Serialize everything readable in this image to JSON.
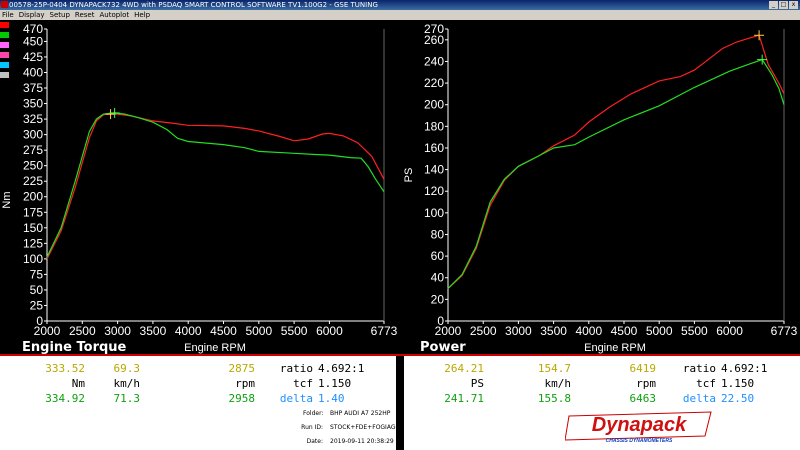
{
  "window": {
    "title": "00578-25P-0404 DYNAPACK732 4WD with PSDAQ SMART CONTROL SOFTWARE TV1.100G2 - GSE TUNING",
    "buttons": [
      "_",
      "□",
      "x"
    ]
  },
  "menu": [
    "File",
    "Display",
    "Setup",
    "Reset",
    "Autoplot",
    "Help"
  ],
  "legend_colors": [
    "#ff0000",
    "#00cc00",
    "#ff66ff",
    "#ff44aa",
    "#00c8ff",
    "#c0c0c0"
  ],
  "charts": {
    "torque": {
      "section_label": "Engine Torque",
      "xlabel": "Engine RPM",
      "ylabel": "Nm"
    },
    "power": {
      "section_label": "Power",
      "xlabel": "Engine RPM",
      "ylabel": "PS"
    }
  },
  "chart_data": [
    {
      "type": "line",
      "xlabel": "Engine RPM",
      "ylabel": "Nm",
      "xlim": [
        2000,
        6773
      ],
      "ylim": [
        0,
        470
      ],
      "x_ticks": [
        "2000",
        "2500",
        "3000",
        "3500",
        "4000",
        "4500",
        "5000",
        "5500",
        "6000",
        "6773"
      ],
      "y_ticks": [
        0,
        25,
        50,
        75,
        100,
        125,
        150,
        175,
        200,
        225,
        250,
        275,
        300,
        325,
        350,
        375,
        400,
        425,
        450,
        470
      ],
      "series": [
        {
          "color": "#ff2020",
          "points": [
            [
              2000,
              100
            ],
            [
              2200,
              145
            ],
            [
              2400,
              215
            ],
            [
              2600,
              295
            ],
            [
              2700,
              322
            ],
            [
              2800,
              332
            ],
            [
              2900,
              333
            ],
            [
              3000,
              333
            ],
            [
              3200,
              330
            ],
            [
              3500,
              322
            ],
            [
              3800,
              318
            ],
            [
              4000,
              315
            ],
            [
              4500,
              314
            ],
            [
              4800,
              310
            ],
            [
              5000,
              306
            ],
            [
              5300,
              297
            ],
            [
              5500,
              290
            ],
            [
              5700,
              293
            ],
            [
              5900,
              301
            ],
            [
              6000,
              302
            ],
            [
              6200,
              298
            ],
            [
              6400,
              287
            ],
            [
              6600,
              265
            ],
            [
              6773,
              228
            ]
          ]
        },
        {
          "color": "#22dd22",
          "points": [
            [
              2000,
              103
            ],
            [
              2200,
              150
            ],
            [
              2400,
              225
            ],
            [
              2600,
              305
            ],
            [
              2700,
              325
            ],
            [
              2800,
              333
            ],
            [
              2958,
              334.92
            ],
            [
              3100,
              333
            ],
            [
              3300,
              327
            ],
            [
              3500,
              320
            ],
            [
              3700,
              308
            ],
            [
              3850,
              294
            ],
            [
              4000,
              289
            ],
            [
              4500,
              284
            ],
            [
              4800,
              279
            ],
            [
              5000,
              273
            ],
            [
              5500,
              270
            ],
            [
              5800,
              268
            ],
            [
              6000,
              267
            ],
            [
              6300,
              263
            ],
            [
              6450,
              262
            ],
            [
              6550,
              248
            ],
            [
              6650,
              229
            ],
            [
              6773,
              208
            ]
          ]
        }
      ]
    },
    {
      "type": "line",
      "xlabel": "Engine RPM",
      "ylabel": "PS",
      "xlim": [
        2000,
        6773
      ],
      "ylim": [
        0,
        270
      ],
      "x_ticks": [
        "2000",
        "2500",
        "3000",
        "3500",
        "4000",
        "4500",
        "5000",
        "5500",
        "6000",
        "6773"
      ],
      "y_ticks": [
        0,
        20,
        40,
        60,
        80,
        100,
        120,
        140,
        160,
        180,
        200,
        220,
        240,
        260,
        270
      ],
      "series": [
        {
          "color": "#ff2020",
          "points": [
            [
              2000,
              30
            ],
            [
              2200,
              42
            ],
            [
              2400,
              67
            ],
            [
              2600,
              107
            ],
            [
              2800,
              130
            ],
            [
              3000,
              143
            ],
            [
              3300,
              153
            ],
            [
              3500,
              162
            ],
            [
              3800,
              172
            ],
            [
              4000,
              184
            ],
            [
              4300,
              198
            ],
            [
              4600,
              210
            ],
            [
              5000,
              222
            ],
            [
              5300,
              226
            ],
            [
              5500,
              232
            ],
            [
              5700,
              242
            ],
            [
              5900,
              252
            ],
            [
              6100,
              258
            ],
            [
              6300,
              262
            ],
            [
              6419,
              264.21
            ],
            [
              6550,
              237
            ],
            [
              6700,
              220
            ],
            [
              6773,
              210
            ]
          ]
        },
        {
          "color": "#22dd22",
          "points": [
            [
              2000,
              30
            ],
            [
              2200,
              43
            ],
            [
              2400,
              69
            ],
            [
              2600,
              110
            ],
            [
              2800,
              131
            ],
            [
              3000,
              143
            ],
            [
              3300,
              153
            ],
            [
              3500,
              160
            ],
            [
              3800,
              163
            ],
            [
              4000,
              170
            ],
            [
              4500,
              186
            ],
            [
              5000,
              199
            ],
            [
              5500,
              216
            ],
            [
              6000,
              231
            ],
            [
              6300,
              238
            ],
            [
              6463,
              241.71
            ],
            [
              6600,
              228
            ],
            [
              6700,
              215
            ],
            [
              6773,
              200
            ]
          ]
        }
      ]
    }
  ],
  "readouts": {
    "torque": {
      "row1": [
        "333.52",
        "69.3",
        "2875"
      ],
      "row1_ratio_label": "ratio",
      "row1_ratio": "4.692:1",
      "units": [
        "Nm",
        "km/h",
        "rpm"
      ],
      "tcf_label": "tcf",
      "tcf": "1.150",
      "row3": [
        "334.92",
        "71.3",
        "2958"
      ],
      "delta_label": "delta",
      "delta": "1.40"
    },
    "power": {
      "row1": [
        "264.21",
        "154.7",
        "6419"
      ],
      "row1_ratio_label": "ratio",
      "row1_ratio": "4.692:1",
      "units": [
        "PS",
        "km/h",
        "rpm"
      ],
      "tcf_label": "tcf",
      "tcf": "1.150",
      "row3": [
        "241.71",
        "155.8",
        "6463"
      ],
      "delta_label": "delta",
      "delta": "22.50"
    }
  },
  "info": {
    "folder_label": "Folder:",
    "folder": "BHP AUDI A7 252HP",
    "run_label": "Run ID:",
    "run": "STOCK+FDE+FOGIAGO",
    "date_label": "Date:",
    "date": "2019-09-11 20:38:29"
  },
  "logo": {
    "text": "Dynapack",
    "subtext": "CHASSIS DYNAMOMETERS"
  }
}
